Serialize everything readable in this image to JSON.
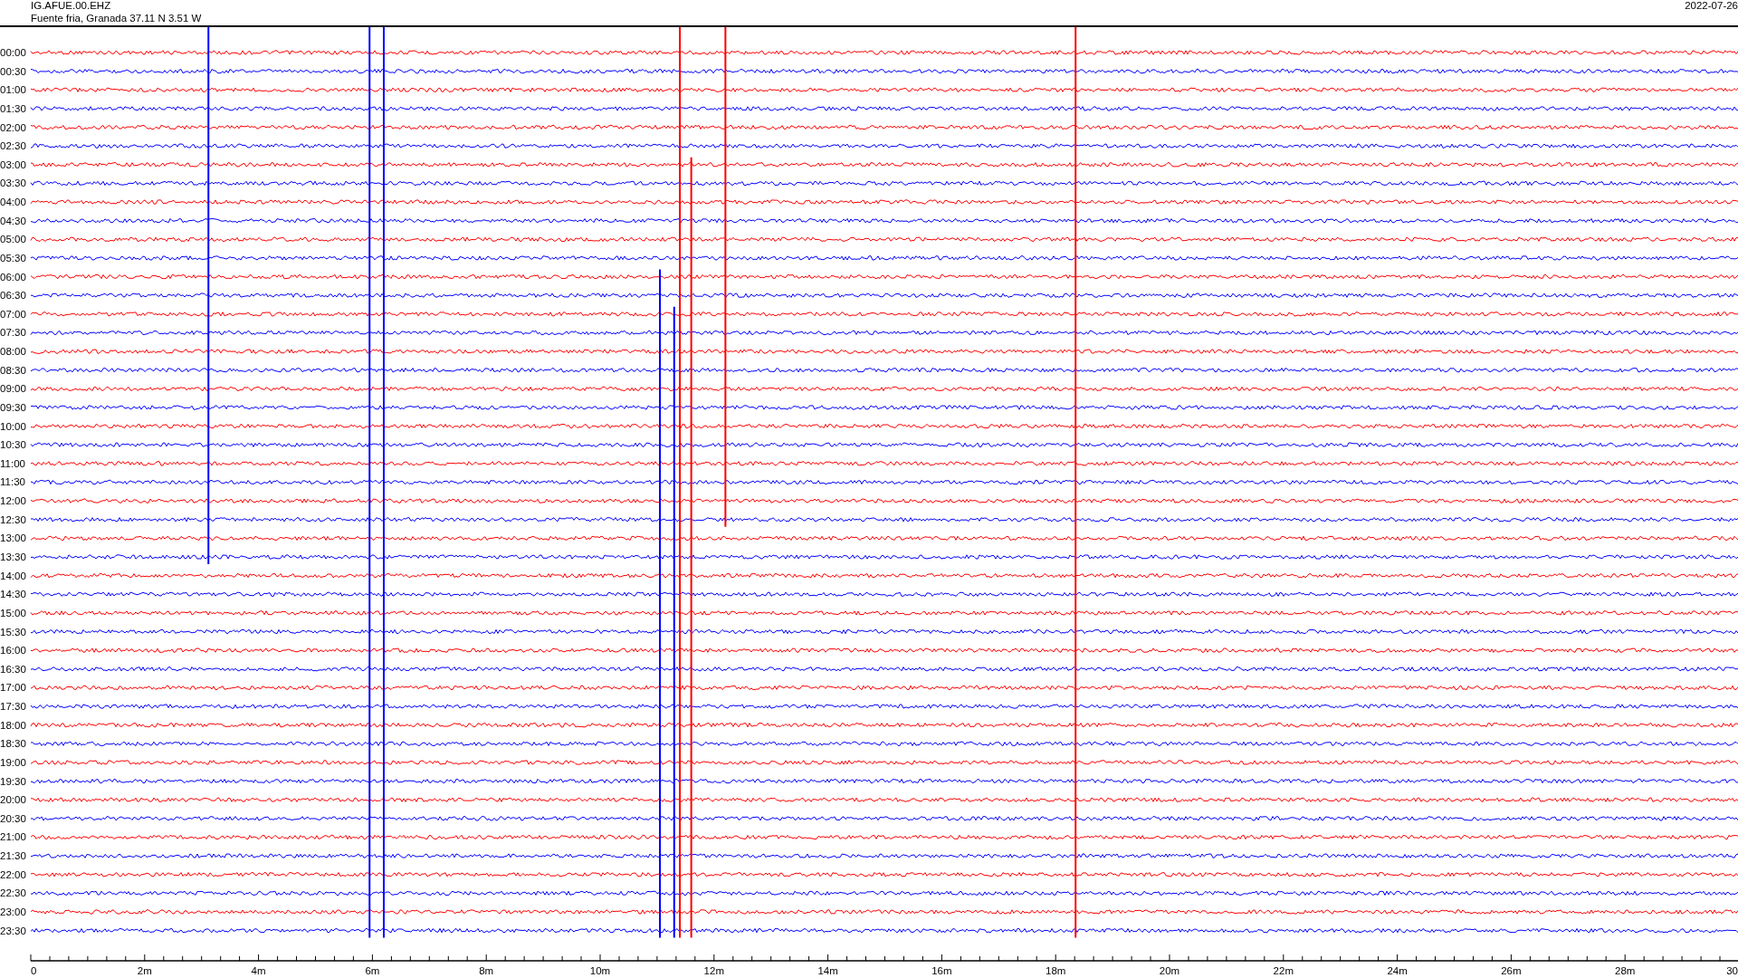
{
  "header": {
    "station": "IG.AFUE.00.EHZ",
    "location": "Fuente fria, Granada  37.11 N 3.51 W",
    "date": "2022-07-26"
  },
  "rows": [
    {
      "label": "00:00",
      "color": "#ff0000"
    },
    {
      "label": "00:30",
      "color": "#0000ff"
    },
    {
      "label": "01:00",
      "color": "#ff0000"
    },
    {
      "label": "01:30",
      "color": "#0000ff"
    },
    {
      "label": "02:00",
      "color": "#ff0000"
    },
    {
      "label": "02:30",
      "color": "#0000ff"
    },
    {
      "label": "03:00",
      "color": "#ff0000"
    },
    {
      "label": "03:30",
      "color": "#0000ff"
    },
    {
      "label": "04:00",
      "color": "#ff0000"
    },
    {
      "label": "04:30",
      "color": "#0000ff"
    },
    {
      "label": "05:00",
      "color": "#ff0000"
    },
    {
      "label": "05:30",
      "color": "#0000ff"
    },
    {
      "label": "06:00",
      "color": "#ff0000"
    },
    {
      "label": "06:30",
      "color": "#0000ff"
    },
    {
      "label": "07:00",
      "color": "#ff0000"
    },
    {
      "label": "07:30",
      "color": "#0000ff"
    },
    {
      "label": "08:00",
      "color": "#ff0000"
    },
    {
      "label": "08:30",
      "color": "#0000ff"
    },
    {
      "label": "09:00",
      "color": "#ff0000"
    },
    {
      "label": "09:30",
      "color": "#0000ff"
    },
    {
      "label": "10:00",
      "color": "#ff0000"
    },
    {
      "label": "10:30",
      "color": "#0000ff"
    },
    {
      "label": "11:00",
      "color": "#ff0000"
    },
    {
      "label": "11:30",
      "color": "#0000ff"
    },
    {
      "label": "12:00",
      "color": "#ff0000"
    },
    {
      "label": "12:30",
      "color": "#0000ff"
    },
    {
      "label": "13:00",
      "color": "#ff0000"
    },
    {
      "label": "13:30",
      "color": "#0000ff"
    },
    {
      "label": "14:00",
      "color": "#ff0000"
    },
    {
      "label": "14:30",
      "color": "#0000ff"
    },
    {
      "label": "15:00",
      "color": "#ff0000"
    },
    {
      "label": "15:30",
      "color": "#0000ff"
    },
    {
      "label": "16:00",
      "color": "#ff0000"
    },
    {
      "label": "16:30",
      "color": "#0000ff"
    },
    {
      "label": "17:00",
      "color": "#ff0000"
    },
    {
      "label": "17:30",
      "color": "#0000ff"
    },
    {
      "label": "18:00",
      "color": "#ff0000"
    },
    {
      "label": "18:30",
      "color": "#0000ff"
    },
    {
      "label": "19:00",
      "color": "#ff0000"
    },
    {
      "label": "19:30",
      "color": "#0000ff"
    },
    {
      "label": "20:00",
      "color": "#ff0000"
    },
    {
      "label": "20:30",
      "color": "#0000ff"
    },
    {
      "label": "21:00",
      "color": "#ff0000"
    },
    {
      "label": "21:30",
      "color": "#0000ff"
    },
    {
      "label": "22:00",
      "color": "#ff0000"
    },
    {
      "label": "22:30",
      "color": "#0000ff"
    },
    {
      "label": "23:00",
      "color": "#ff0000"
    },
    {
      "label": "23:30",
      "color": "#0000ff"
    }
  ],
  "x_axis": {
    "ticks": [
      "0",
      "2m",
      "4m",
      "6m",
      "8m",
      "10m",
      "12m",
      "14m",
      "16m",
      "18m",
      "20m",
      "22m",
      "24m",
      "26m",
      "28m",
      "30"
    ]
  }
}
